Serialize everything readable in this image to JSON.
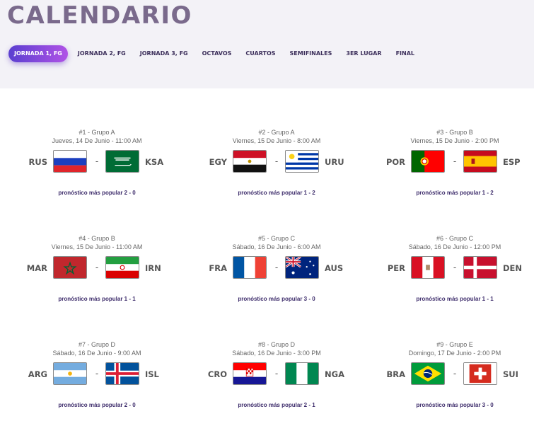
{
  "header": {
    "title": "CALENDARIO",
    "tabs": [
      {
        "label": "JORNADA 1, FG"
      },
      {
        "label": "JORNADA 2, FG"
      },
      {
        "label": "JORNADA 3, FG"
      },
      {
        "label": "OCTAVOS"
      },
      {
        "label": "CUARTOS"
      },
      {
        "label": "SEMIFINALES"
      },
      {
        "label": "3ER LUGAR"
      },
      {
        "label": "FINAL"
      }
    ]
  },
  "matches": [
    {
      "number": "#1 - Grupo A",
      "date": "Jueves, 14 De Junio - 11:00 AM",
      "home": "RUS",
      "away": "KSA",
      "separator": "-",
      "popular": "pronóstico más popular 2 - 0"
    },
    {
      "number": "#2 - Grupo A",
      "date": "Viernes, 15 De Junio - 8:00 AM",
      "home": "EGY",
      "away": "URU",
      "separator": "-",
      "popular": "pronóstico más popular 1 - 2"
    },
    {
      "number": "#3 - Grupo B",
      "date": "Viernes, 15 De Junio - 2:00 PM",
      "home": "POR",
      "away": "ESP",
      "separator": "-",
      "popular": "pronóstico más popular 1 - 2"
    },
    {
      "number": "#4 - Grupo B",
      "date": "Viernes, 15 De Junio - 11:00 AM",
      "home": "MAR",
      "away": "IRN",
      "separator": "-",
      "popular": "pronóstico más popular 1 - 1"
    },
    {
      "number": "#5 - Grupo C",
      "date": "Sábado, 16 De Junio - 6:00 AM",
      "home": "FRA",
      "away": "AUS",
      "separator": "-",
      "popular": "pronóstico más popular 3 - 0"
    },
    {
      "number": "#6 - Grupo C",
      "date": "Sábado, 16 De Junio - 12:00 PM",
      "home": "PER",
      "away": "DEN",
      "separator": "-",
      "popular": "pronóstico más popular 1 - 1"
    },
    {
      "number": "#7 - Grupo D",
      "date": "Sábado, 16 De Junio - 9:00 AM",
      "home": "ARG",
      "away": "ISL",
      "separator": "-",
      "popular": "pronóstico más popular 2 - 0"
    },
    {
      "number": "#8 - Grupo D",
      "date": "Sábado, 16 De Junio - 3:00 PM",
      "home": "CRO",
      "away": "NGA",
      "separator": "-",
      "popular": "pronóstico más popular 2 - 1"
    },
    {
      "number": "#9 - Grupo E",
      "date": "Domingo, 17 De Junio - 2:00 PM",
      "home": "BRA",
      "away": "SUI",
      "separator": "-",
      "popular": "pronóstico más popular 3 - 0"
    }
  ]
}
